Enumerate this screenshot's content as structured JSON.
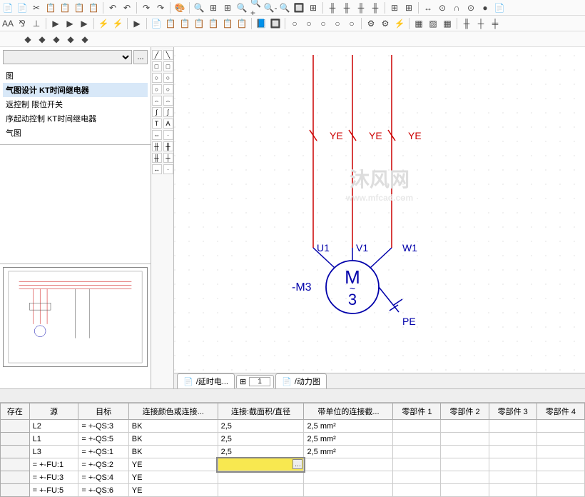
{
  "toolbar_icons_row1": [
    "📄",
    "📄",
    "✂",
    "📋",
    "📋",
    "📋",
    "📋",
    "│",
    "↶",
    "↶",
    "│",
    "↷",
    "↷",
    "│",
    "🎨",
    "│",
    "🔍",
    "⊞",
    "⊞",
    "🔍",
    "🔍+",
    "🔍-",
    "🔍",
    "🔲",
    "⊞",
    "│",
    "╫",
    "╫",
    "╫",
    "╫",
    "│",
    "⊞",
    "⊞",
    "│",
    "↔",
    "⊙",
    "∩",
    "⊙",
    "●",
    "📄"
  ],
  "toolbar_icons_row2": [
    "AA",
    "⅋",
    "⊥",
    "│",
    "▶",
    "▶",
    "▶",
    "│",
    "⚡",
    "⚡",
    "│",
    "▶",
    "│",
    "📄",
    "📋",
    "📋",
    "📋",
    "📋",
    "📋",
    "📋",
    "│",
    "📘",
    "🔲",
    "│",
    "○",
    "○",
    "○",
    "○",
    "○",
    "│",
    "⚙",
    "⚙",
    "⚡",
    "│",
    "▦",
    "▨",
    "▦",
    "│",
    "╫",
    "┼",
    "╪"
  ],
  "toolbar_icons_row3": [
    "◆",
    "◆",
    "◆",
    "◆",
    "◆"
  ],
  "tree": {
    "items": [
      {
        "label": "图",
        "sel": false
      },
      {
        "label": "气图设计 KT时间继电器",
        "sel": true
      },
      {
        "label": "返控制 限位开关",
        "sel": false
      },
      {
        "label": "序起动控制 KT时间继电器",
        "sel": false
      },
      {
        "label": "气图",
        "sel": false
      }
    ]
  },
  "tool_column": [
    "╱",
    "╲",
    "□",
    "□",
    "○",
    "○",
    "○",
    "○",
    "⌢",
    "⌢",
    "∫",
    "∫",
    "T",
    "A",
    "⇔",
    "·",
    "╫",
    "╫",
    "╫",
    "┼",
    "↔",
    "·"
  ],
  "schematic": {
    "wire_labels": [
      "YE",
      "YE",
      "YE"
    ],
    "motor_label_top": "M",
    "motor_label_sub": "~",
    "motor_label_bottom": "3",
    "motor_ref": "-M3",
    "terminals": [
      "U1",
      "V1",
      "W1"
    ],
    "pe_label": "PE"
  },
  "sheet_tabs": {
    "tab1": "/延时电...",
    "page": "1",
    "tab2": "/动力图"
  },
  "grid": {
    "headers": [
      "存在",
      "源",
      "目标",
      "连接颜色或连接...",
      "连接:截面积/直径",
      "带单位的连接截...",
      "零部件 1",
      "零部件 2",
      "零部件 3",
      "零部件 4"
    ],
    "rows": [
      {
        "src": "L2",
        "tgt": "= +-QS:3",
        "col": "BK",
        "cs": "2,5",
        "csu": "2,5 mm²"
      },
      {
        "src": "L1",
        "tgt": "= +-QS:5",
        "col": "BK",
        "cs": "2,5",
        "csu": "2,5 mm²"
      },
      {
        "src": "L3",
        "tgt": "= +-QS:1",
        "col": "BK",
        "cs": "2,5",
        "csu": "2,5 mm²"
      },
      {
        "src": "= +-FU:1",
        "tgt": "= +-QS:2",
        "col": "YE",
        "cs": "",
        "csu": "",
        "sel": true
      },
      {
        "src": "= +-FU:3",
        "tgt": "= +-QS:4",
        "col": "YE",
        "cs": "",
        "csu": ""
      },
      {
        "src": "= +-FU:5",
        "tgt": "= +-QS:6",
        "col": "YE",
        "cs": "",
        "csu": ""
      }
    ]
  },
  "watermark": {
    "main": "沐风网",
    "sub": "www.mfcad.com"
  }
}
